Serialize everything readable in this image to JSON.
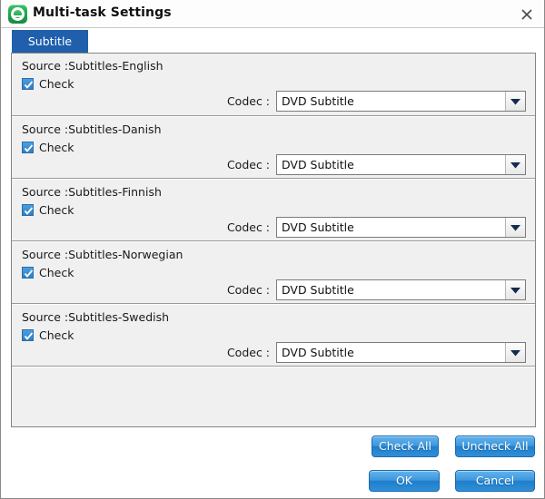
{
  "window": {
    "title": "Multi-task Settings",
    "app_icon": "app-logo-icon",
    "close_icon": "close-icon",
    "accent_color": "#1f5fac",
    "button_color": "#2f8fd8",
    "checkbox_color": "#3586c9"
  },
  "tabs": [
    {
      "label": "Subtitle",
      "selected": true
    }
  ],
  "sources": [
    {
      "source_label": "Source :Subtitles-English",
      "check_label": "Check",
      "checked": true,
      "codec_label": "Codec :",
      "codec_value": "DVD Subtitle"
    },
    {
      "source_label": "Source :Subtitles-Danish",
      "check_label": "Check",
      "checked": true,
      "codec_label": "Codec :",
      "codec_value": "DVD Subtitle"
    },
    {
      "source_label": "Source :Subtitles-Finnish",
      "check_label": "Check",
      "checked": true,
      "codec_label": "Codec :",
      "codec_value": "DVD Subtitle"
    },
    {
      "source_label": "Source :Subtitles-Norwegian",
      "check_label": "Check",
      "checked": true,
      "codec_label": "Codec :",
      "codec_value": "DVD Subtitle"
    },
    {
      "source_label": "Source :Subtitles-Swedish",
      "check_label": "Check",
      "checked": true,
      "codec_label": "Codec :",
      "codec_value": "DVD Subtitle"
    }
  ],
  "footer": {
    "check_all_label": "Check All",
    "uncheck_all_label": "Uncheck All",
    "ok_label": "OK",
    "cancel_label": "Cancel"
  }
}
